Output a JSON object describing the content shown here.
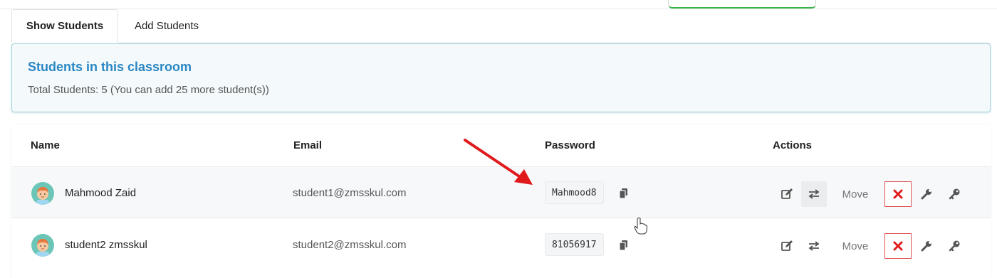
{
  "tabs": [
    {
      "label": "Show Students",
      "active": true
    },
    {
      "label": "Add Students",
      "active": false
    }
  ],
  "info": {
    "title": "Students in this classroom",
    "subtitle": "Total Students: 5 (You can add 25 more student(s))"
  },
  "table": {
    "headers": {
      "name": "Name",
      "email": "Email",
      "password": "Password",
      "actions": "Actions"
    },
    "rows": [
      {
        "name": "Mahmood Zaid",
        "email": "student1@zmsskul.com",
        "password": "Mahmood8",
        "move_label": "Move"
      },
      {
        "name": "student2 zmsskul",
        "email": "student2@zmsskul.com",
        "password": "81056917",
        "move_label": "Move"
      }
    ]
  },
  "colors": {
    "accent": "#2a87c4",
    "danger": "#e05252",
    "annotation_arrow": "#e0191c"
  },
  "icons": [
    "avatar-icon",
    "copy-icon",
    "edit-icon",
    "transfer-icon",
    "delete-icon",
    "wrench-icon",
    "key-icon",
    "arrow-annotation",
    "hand-cursor-icon"
  ]
}
